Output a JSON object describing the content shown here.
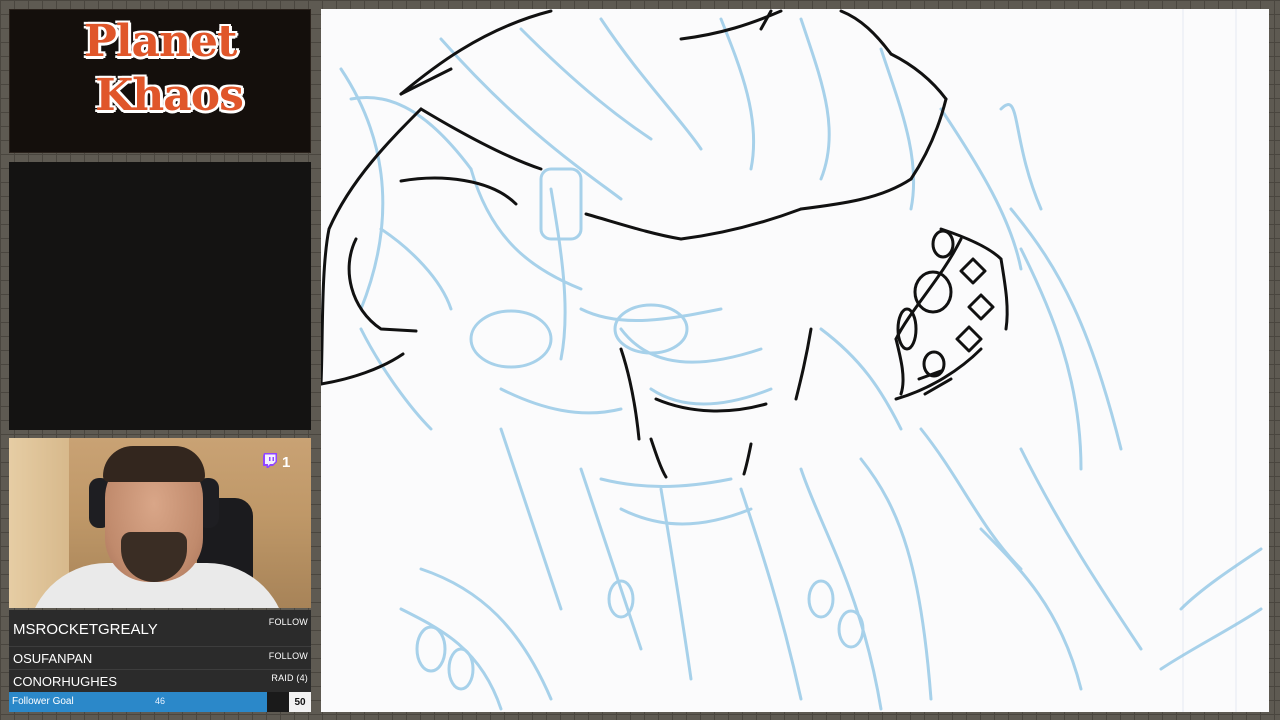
{
  "logo": {
    "line1": "Planet",
    "line2": "Khaos",
    "color": "#e0562a"
  },
  "webcam": {
    "viewer_icon": "twitch-icon",
    "viewer_count": "1"
  },
  "events": {
    "items": [
      {
        "name": "MSROCKETGREALY",
        "action": "FOLLOW"
      },
      {
        "name": "OSUFANPAN",
        "action": "FOLLOW"
      },
      {
        "name": "CONORHUGHES",
        "action": "RAID (4)"
      }
    ],
    "goal": {
      "label": "Follower Goal",
      "current": "46",
      "target": "50",
      "progress": 0.92,
      "color": "#2b88c9"
    }
  },
  "canvas": {
    "sketch_color": "#8cc4e4",
    "ink_color": "#111111"
  }
}
